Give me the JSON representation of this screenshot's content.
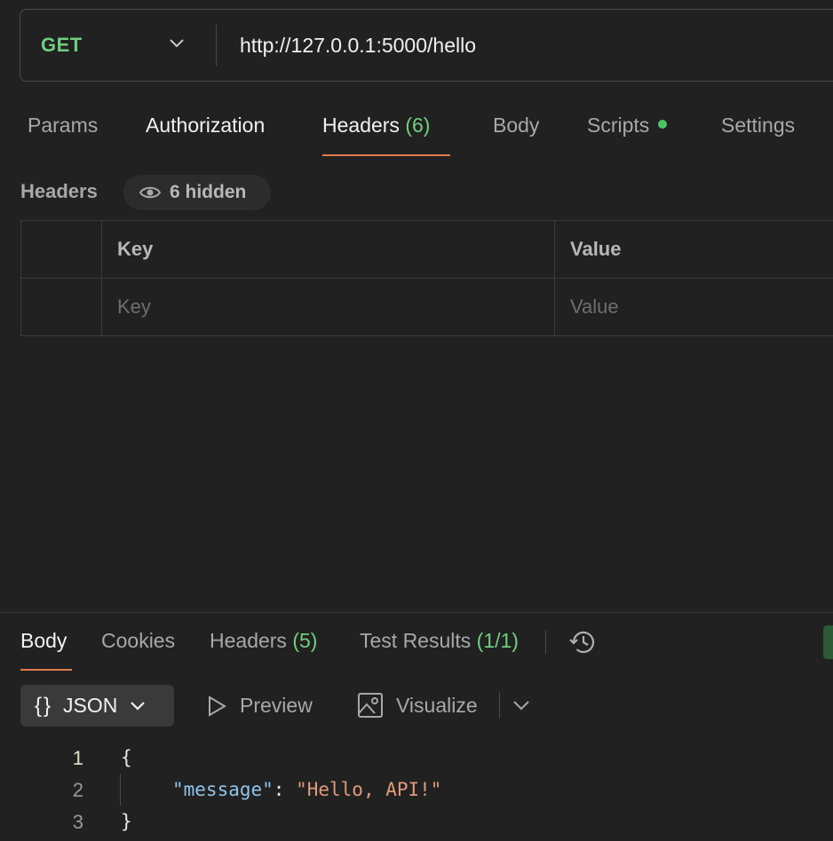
{
  "request": {
    "method": "GET",
    "url": "http://127.0.0.1:5000/hello"
  },
  "request_tabs": {
    "params": "Params",
    "authorization": "Authorization",
    "headers": "Headers",
    "headers_count": "(6)",
    "body": "Body",
    "scripts": "Scripts",
    "settings": "Settings"
  },
  "headers_section": {
    "title": "Headers",
    "hidden_label": "6 hidden",
    "columns": {
      "key": "Key",
      "value": "Value"
    },
    "placeholder": {
      "key": "Key",
      "value": "Value"
    }
  },
  "response_tabs": {
    "body": "Body",
    "cookies": "Cookies",
    "headers": "Headers",
    "headers_count": "(5)",
    "tests": "Test Results",
    "tests_count": "(1/1)"
  },
  "format_bar": {
    "format": "JSON",
    "preview": "Preview",
    "visualize": "Visualize"
  },
  "response_body": {
    "lines": [
      {
        "no": "1",
        "text": "{"
      },
      {
        "no": "2",
        "key": "\"message\"",
        "sep": ": ",
        "value": "\"Hello, API!\""
      },
      {
        "no": "3",
        "text": "}"
      }
    ]
  },
  "colors": {
    "method_get": "#6fcf7f",
    "accent_underline": "#e07a4c",
    "status_dot": "#4cc463",
    "json_key": "#8fc4ea",
    "json_string": "#e09a7a"
  },
  "icons": [
    "chevron-down-icon",
    "eye-icon",
    "history-icon",
    "play-icon",
    "image-icon"
  ]
}
